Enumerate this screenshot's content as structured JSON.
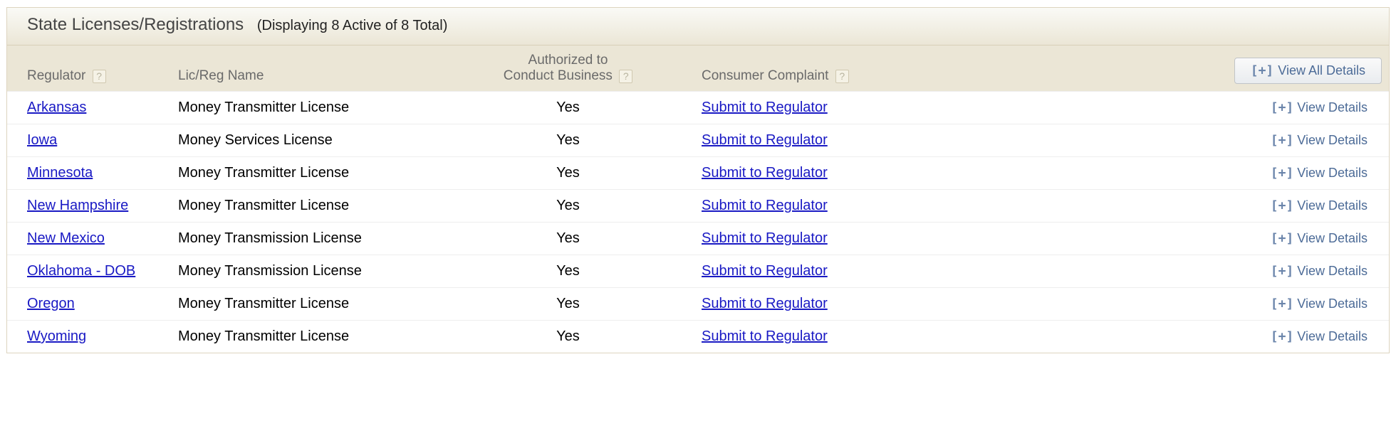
{
  "header": {
    "title": "State Licenses/Registrations",
    "count_text": "(Displaying 8 Active of 8 Total)"
  },
  "columns": {
    "regulator": "Regulator",
    "lic_name": "Lic/Reg Name",
    "authorized_line1": "Authorized to",
    "authorized_line2": "Conduct Business",
    "complaint": "Consumer Complaint",
    "view_all": "View All Details",
    "view_details": "View Details"
  },
  "icons": {
    "help": "?"
  },
  "rows": [
    {
      "regulator": "Arkansas",
      "lic": "Money Transmitter License",
      "auth": "Yes",
      "complaint": "Submit to Regulator"
    },
    {
      "regulator": "Iowa",
      "lic": "Money Services License",
      "auth": "Yes",
      "complaint": "Submit to Regulator"
    },
    {
      "regulator": "Minnesota",
      "lic": "Money Transmitter License",
      "auth": "Yes",
      "complaint": "Submit to Regulator"
    },
    {
      "regulator": "New Hampshire",
      "lic": "Money Transmitter License",
      "auth": "Yes",
      "complaint": "Submit to Regulator"
    },
    {
      "regulator": "New Mexico",
      "lic": "Money Transmission License",
      "auth": "Yes",
      "complaint": "Submit to Regulator"
    },
    {
      "regulator": "Oklahoma - DOB",
      "lic": "Money Transmission License",
      "auth": "Yes",
      "complaint": "Submit to Regulator"
    },
    {
      "regulator": "Oregon",
      "lic": "Money Transmitter License",
      "auth": "Yes",
      "complaint": "Submit to Regulator"
    },
    {
      "regulator": "Wyoming",
      "lic": "Money Transmitter License",
      "auth": "Yes",
      "complaint": "Submit to Regulator"
    }
  ]
}
